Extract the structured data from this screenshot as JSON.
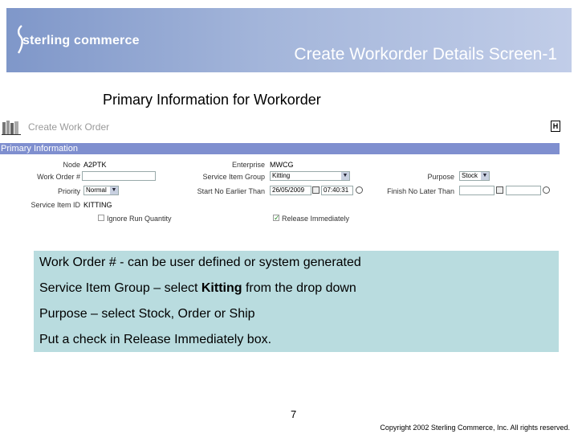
{
  "banner": {
    "logo_text": "sterling commerce",
    "slide_title": "Create Workorder Details Screen-1",
    "subtitle": "Primary Information for Workorder"
  },
  "screen": {
    "title": "Create Work Order",
    "help_label": "H",
    "section": "Primary Information",
    "fields": {
      "node_label": "Node",
      "node_value": "A2PTK",
      "enterprise_label": "Enterprise",
      "enterprise_value": "MWCG",
      "work_order_label": "Work Order #",
      "work_order_value": "",
      "service_item_group_label": "Service Item Group",
      "service_item_group_value": "Kitting",
      "purpose_label": "Purpose",
      "purpose_value": "Stock",
      "priority_label": "Priority",
      "priority_value": "Normal",
      "start_label": "Start No Earlier Than",
      "start_date": "26/05/2009",
      "start_time": "07:40:31",
      "finish_label": "Finish No Later Than",
      "finish_date": "",
      "finish_time": "",
      "service_item_id_label": "Service Item ID",
      "service_item_id_value": "KITTING",
      "ignore_run_qty_label": "Ignore Run Quantity",
      "ignore_run_qty_checked": false,
      "release_immediately_label": "Release Immediately",
      "release_immediately_checked": true
    }
  },
  "notes": {
    "line1": "Work Order # - can be user defined or system generated",
    "line2_pre": "Service Item Group – select ",
    "line2_bold": "Kitting",
    "line2_post": " from the drop down",
    "line3": "Purpose – select Stock, Order or Ship",
    "line4": "Put a check in Release Immediately box."
  },
  "footer": {
    "page_number": "7",
    "copyright": "Copyright 2002 Sterling Commerce, Inc. All rights reserved."
  },
  "colors": {
    "banner_start": "#7f97c9",
    "section_bar": "#7f8fcf",
    "note_bg": "#b9dcdf"
  }
}
